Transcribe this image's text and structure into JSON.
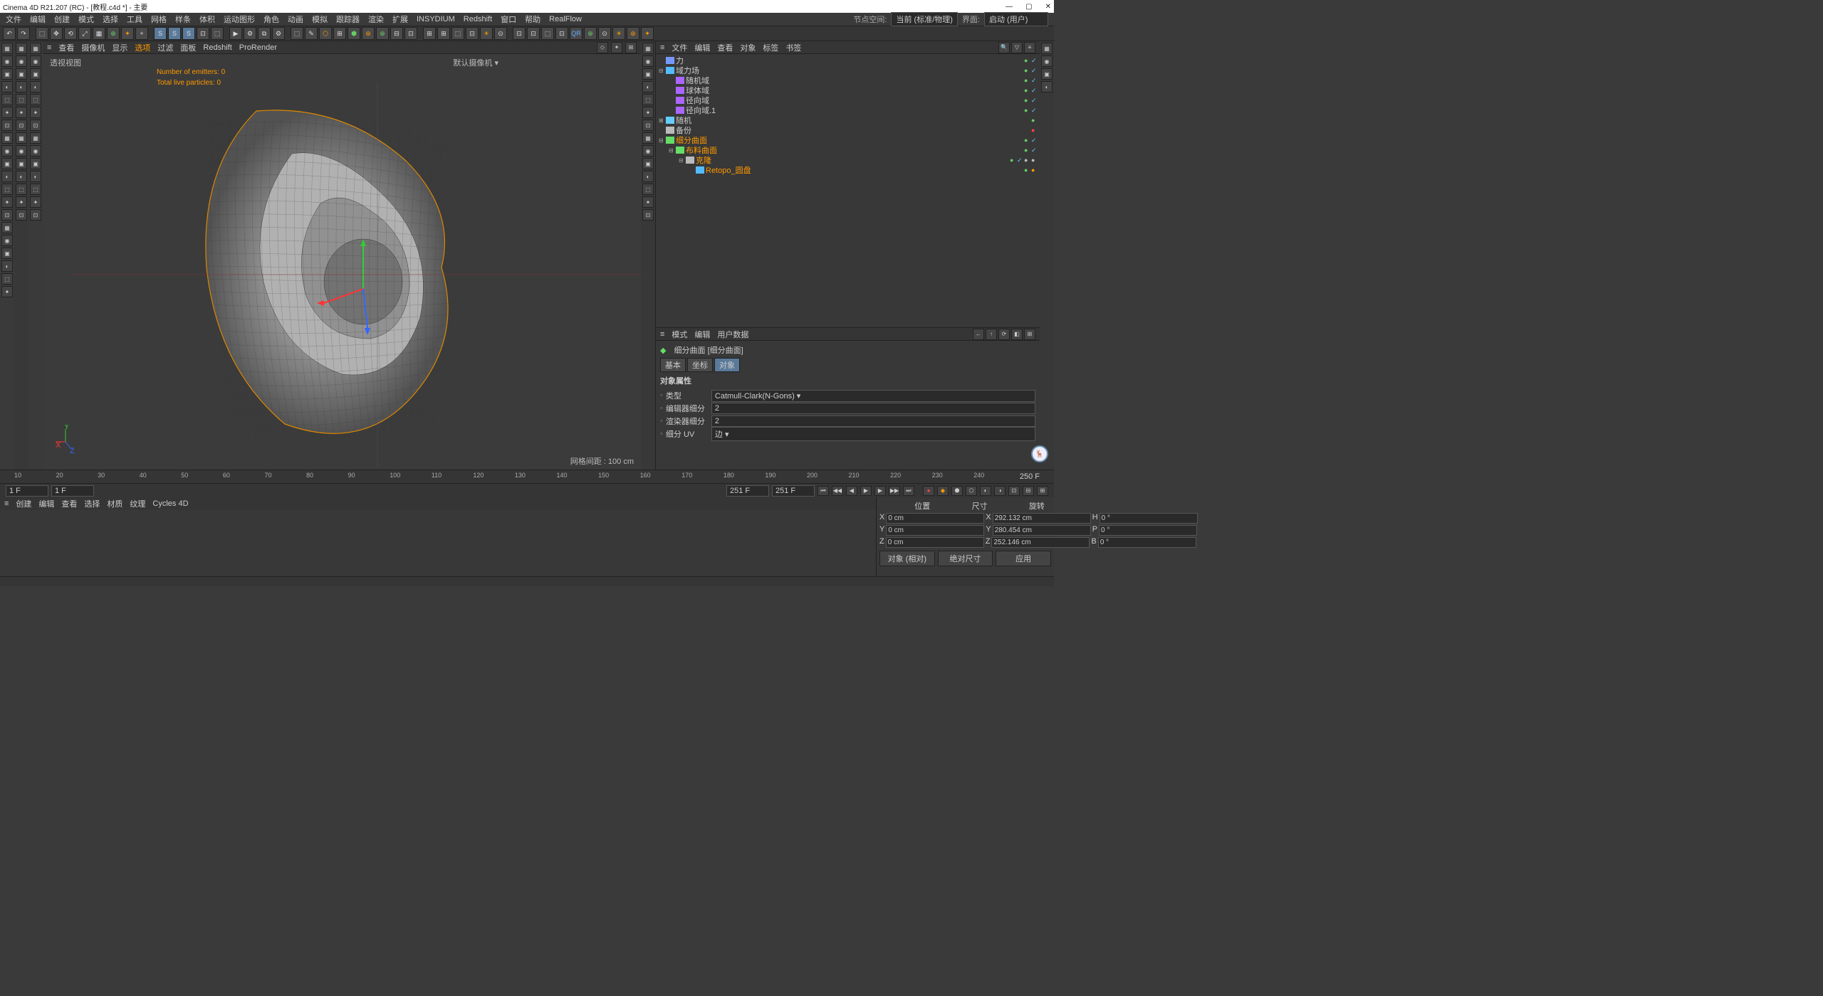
{
  "title": "Cinema 4D R21.207 (RC) - [教程.c4d *] - 主要",
  "menu": [
    "文件",
    "编辑",
    "创建",
    "模式",
    "选择",
    "工具",
    "网格",
    "样条",
    "体积",
    "运动图形",
    "角色",
    "动画",
    "模拟",
    "跟踪器",
    "渲染",
    "扩展",
    "INSYDIUM",
    "Redshift",
    "窗口",
    "帮助",
    "RealFlow"
  ],
  "node_space_label": "节点空间:",
  "node_space_value": "当前 (标准/物理)",
  "layout_label": "界面:",
  "layout_value": "启动 (用户)",
  "vp_menu": [
    "≡",
    "查看",
    "摄像机",
    "显示",
    "选项",
    "过滤",
    "面板",
    "Redshift",
    "ProRender"
  ],
  "vp_menu_sel": 4,
  "vp_label_tl": "透视视图",
  "vp_label_tr": "默认摄像机 ▾",
  "emitters": "Number of emitters: 0",
  "particles": "Total live particles: 0",
  "grid_info": "网格间距 : 100 cm",
  "obj_menu": [
    "≡",
    "文件",
    "编辑",
    "查看",
    "对象",
    "标签",
    "书签"
  ],
  "tree": [
    {
      "d": 0,
      "exp": "",
      "ico": "#79f",
      "name": "力",
      "sel": false,
      "flags": [
        "g",
        "c"
      ]
    },
    {
      "d": 0,
      "exp": "⊟",
      "ico": "#5bf",
      "name": "域力场",
      "sel": false,
      "flags": [
        "g",
        "c"
      ]
    },
    {
      "d": 1,
      "exp": "",
      "ico": "#a6f",
      "name": "随机域",
      "sel": false,
      "flags": [
        "g",
        "c"
      ]
    },
    {
      "d": 1,
      "exp": "",
      "ico": "#a6f",
      "name": "球体域",
      "sel": false,
      "flags": [
        "g",
        "c"
      ]
    },
    {
      "d": 1,
      "exp": "",
      "ico": "#a6f",
      "name": "径向域",
      "sel": false,
      "flags": [
        "g",
        "c"
      ]
    },
    {
      "d": 1,
      "exp": "",
      "ico": "#a6f",
      "name": "径向域.1",
      "sel": false,
      "flags": [
        "g",
        "c"
      ]
    },
    {
      "d": 0,
      "exp": "⊞",
      "ico": "#6cf",
      "name": "随机",
      "sel": false,
      "flags": [
        "g"
      ]
    },
    {
      "d": 0,
      "exp": "",
      "ico": "#bbb",
      "name": "备份",
      "sel": false,
      "flags": [
        "r"
      ]
    },
    {
      "d": 0,
      "exp": "⊟",
      "ico": "#6d6",
      "name": "细分曲面",
      "sel": true,
      "flags": [
        "g",
        "c"
      ]
    },
    {
      "d": 1,
      "exp": "⊟",
      "ico": "#6d6",
      "name": "布料曲面",
      "sel": true,
      "flags": [
        "g",
        "c"
      ]
    },
    {
      "d": 2,
      "exp": "⊟",
      "ico": "#bbb",
      "name": "克隆",
      "sel": true,
      "flags": [
        "g",
        "c",
        "x",
        "y"
      ]
    },
    {
      "d": 3,
      "exp": "",
      "ico": "#5bf",
      "name": "Retopo_圆盘",
      "sel": true,
      "flags": [
        "g",
        "o"
      ]
    }
  ],
  "attr_menu": [
    "≡",
    "模式",
    "编辑",
    "用户数据"
  ],
  "attr_title": "细分曲面 [细分曲面]",
  "attr_tabs": [
    "基本",
    "坐标",
    "对象"
  ],
  "attr_tab_active": 2,
  "attr_section": "对象属性",
  "attr_rows": [
    {
      "l": "类型",
      "v": "Catmull-Clark(N-Gons)",
      "t": "sel"
    },
    {
      "l": "编辑器细分",
      "v": "2",
      "t": "num"
    },
    {
      "l": "渲染器细分",
      "v": "2",
      "t": "num"
    },
    {
      "l": "细分 UV",
      "v": "边",
      "t": "sel"
    }
  ],
  "timeline_ticks": [
    10,
    20,
    30,
    40,
    50,
    60,
    70,
    80,
    90,
    100,
    110,
    120,
    130,
    140,
    150,
    160,
    170,
    180,
    190,
    200,
    210,
    220,
    230,
    240
  ],
  "timeline_end": "250 F",
  "frame_start": "1 F",
  "frame_start2": "1 F",
  "frame_cur": "251 F",
  "frame_cur2": "251 F",
  "mat_menu": [
    "≡",
    "创建",
    "编辑",
    "查看",
    "选择",
    "材质",
    "纹理",
    "Cycles 4D"
  ],
  "coords_hdr": [
    "位置",
    "尺寸",
    "旋转"
  ],
  "coords": [
    {
      "a": "X",
      "p": "0 cm",
      "s": "292.132 cm",
      "r": "H",
      "rv": "0 °"
    },
    {
      "a": "Y",
      "p": "0 cm",
      "s": "280.454 cm",
      "r": "P",
      "rv": "0 °"
    },
    {
      "a": "Z",
      "p": "0 cm",
      "s": "252.146 cm",
      "r": "B",
      "rv": "0 °"
    }
  ],
  "coord_btns": [
    "对象 (相对)",
    "绝对尺寸",
    "应用"
  ]
}
